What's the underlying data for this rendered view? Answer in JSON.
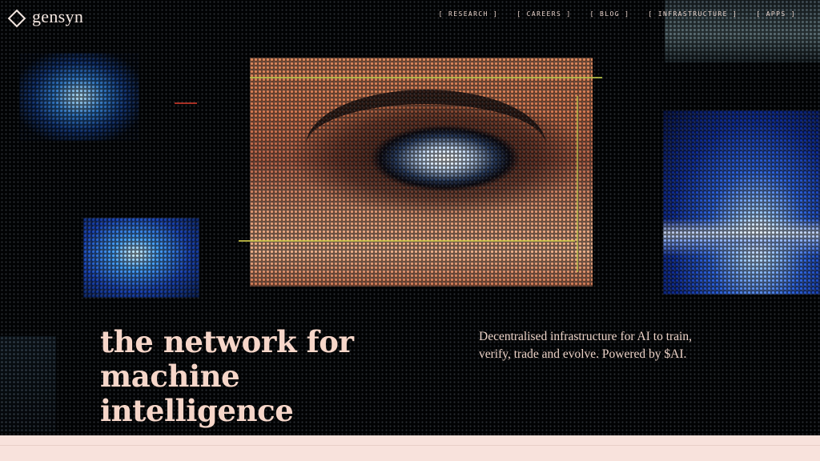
{
  "brand": {
    "name": "gensyn",
    "logo_icon": "diamond-logo-icon"
  },
  "nav": {
    "items": [
      {
        "label": "[ RESEARCH ]"
      },
      {
        "label": "[ CAREERS ]"
      },
      {
        "label": "[ BLOG ]"
      },
      {
        "label": "[ INFRASTRUCTURE ]"
      },
      {
        "label": "[ APPS ]"
      }
    ]
  },
  "hero": {
    "headline_line1": "the network for machine",
    "headline_line2": "intelligence",
    "tagline_line1": "Decentralised infrastructure for AI to train,",
    "tagline_line2": "verify, trade and evolve. Powered by $AI."
  },
  "colors": {
    "background": "#020304",
    "text": "#f6d6c9",
    "footer": "#f8e2dc",
    "accent_scanline": "#c9d64b"
  }
}
